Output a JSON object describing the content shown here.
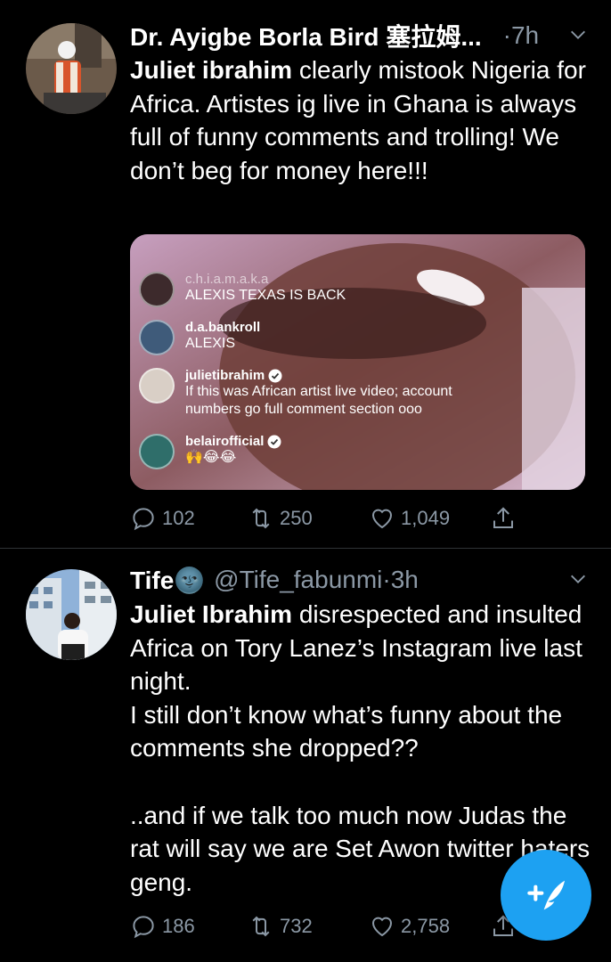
{
  "tweets": [
    {
      "name": "Dr. Ayigbe Borla Bird 塞拉姆...",
      "handle": "",
      "separator": "·",
      "time": "7h",
      "body_bold": "Juliet ibrahim",
      "body_rest": " clearly mistook Nigeria for Africa. Artistes ig live in Ghana is always full of funny comments and trolling! We don’t beg for money here!!!",
      "media": {
        "comments": [
          {
            "user": "c.h.i.a.m.a.k.a",
            "message": "ALEXIS TEXAS IS BACK",
            "verified": false
          },
          {
            "user": "d.a.bankroll",
            "message": "ALEXIS",
            "verified": false
          },
          {
            "user": "julietibrahim",
            "message": "If this was African artist live video; account numbers go full comment section ooo",
            "verified": true
          },
          {
            "user": "belairofficial",
            "message": "🙌😂😂",
            "verified": true
          }
        ]
      },
      "stats": {
        "replies": "102",
        "retweets": "250",
        "likes": "1,049"
      }
    },
    {
      "name": "Tife🌚",
      "handle": "@Tife_fabunmi",
      "separator": "·",
      "time": "3h",
      "body_bold": "Juliet Ibrahim",
      "body_rest": " disrespected and insulted Africa on Tory Lanez’s Instagram live last night.\nI still don’t know what’s funny about the comments she dropped??\n\n..and if we talk too much now Judas the rat will say we are Set Awon twitter haters geng.",
      "stats": {
        "replies": "186",
        "retweets": "732",
        "likes": "2,758"
      }
    }
  ],
  "fab": {
    "icon": "compose-feather-icon"
  },
  "colors": {
    "background": "#000000",
    "secondary_text": "#8b98a5",
    "accent": "#1da1f2",
    "divider": "#2f3336"
  }
}
